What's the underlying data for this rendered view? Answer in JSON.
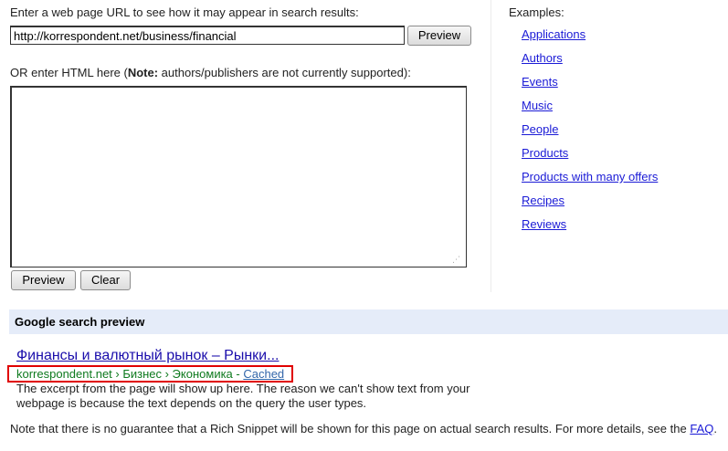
{
  "url_form": {
    "label": "Enter a web page URL to see how it may appear in search results:",
    "url_value": "http://korrespondent.net/business/financial",
    "preview_label": "Preview"
  },
  "html_form": {
    "label_prefix": "OR enter HTML here (",
    "label_bold": "Note:",
    "label_suffix": " authors/publishers are not currently supported):",
    "textarea_value": "",
    "preview_label": "Preview",
    "clear_label": "Clear"
  },
  "examples": {
    "label": "Examples:",
    "items": [
      {
        "label": "Applications"
      },
      {
        "label": "Authors"
      },
      {
        "label": "Events"
      },
      {
        "label": "Music"
      },
      {
        "label": "People"
      },
      {
        "label": "Products"
      },
      {
        "label": "Products with many offers"
      },
      {
        "label": "Recipes"
      },
      {
        "label": "Reviews"
      }
    ]
  },
  "preview": {
    "section_title": "Google search preview",
    "result_title": "Финансы и валютный рынок – Рынки...",
    "result_url_main": "korrespondent.net › Бизнес › Экономика - ",
    "result_url_cached": "Cached",
    "snippet": "The excerpt from the page will show up here. The reason we can't show text from your webpage is because the text depends on the query the user types."
  },
  "note": {
    "text": "Note that there is no guarantee that a Rich Snippet will be shown for this page on actual search results. For more details, see the ",
    "link_label": "FAQ",
    "suffix": "."
  },
  "colors": {
    "link": "#1a1ad6",
    "result_title": "#1a0dab",
    "url_green": "#0e7a1e",
    "section_bg": "#e5ecf9",
    "highlight": "#e00000"
  }
}
